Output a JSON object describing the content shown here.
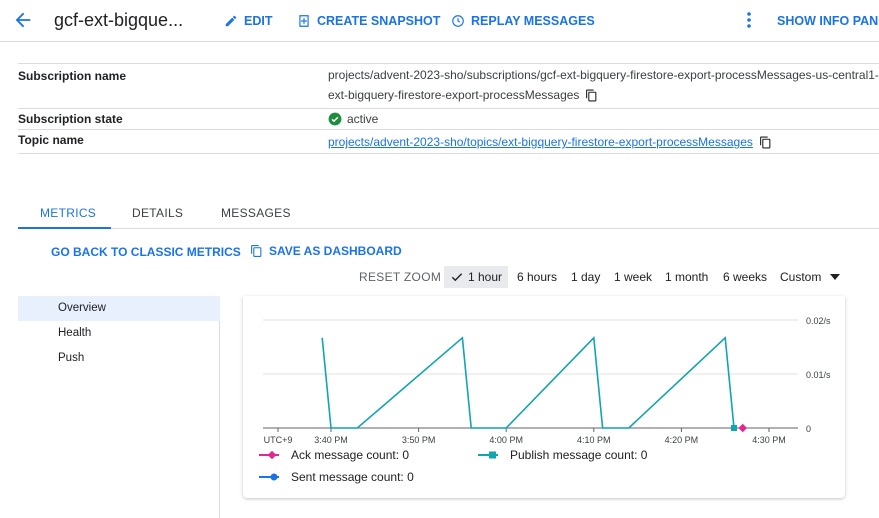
{
  "header": {
    "title": "gcf-ext-bigque...",
    "edit_label": "EDIT",
    "snapshot_label": "CREATE SNAPSHOT",
    "replay_label": "REPLAY MESSAGES",
    "info_panel_label": "SHOW INFO PANEL"
  },
  "details": {
    "subscription_name_label": "Subscription name",
    "subscription_name_line1": "projects/advent-2023-sho/subscriptions/gcf-ext-bigquery-firestore-export-processMessages-us-central1-",
    "subscription_name_line2": "ext-bigquery-firestore-export-processMessages",
    "subscription_state_label": "Subscription state",
    "subscription_state_value": "active",
    "topic_name_label": "Topic name",
    "topic_name_value": "projects/advent-2023-sho/topics/ext-bigquery-firestore-export-processMessages"
  },
  "tabs": [
    {
      "label": "METRICS",
      "active": true
    },
    {
      "label": "DETAILS",
      "active": false
    },
    {
      "label": "MESSAGES",
      "active": false
    }
  ],
  "actions": {
    "classic_metrics": "GO BACK TO CLASSIC METRICS",
    "save_dashboard": "SAVE AS DASHBOARD"
  },
  "time_range": {
    "reset_zoom": "RESET ZOOM",
    "options": [
      "1 hour",
      "6 hours",
      "1 day",
      "1 week",
      "1 month",
      "6 weeks",
      "Custom"
    ],
    "selected": "1 hour"
  },
  "left_nav": {
    "items": [
      "Overview",
      "Health",
      "Push"
    ],
    "selected": "Overview"
  },
  "chart_data": {
    "type": "line",
    "x_ticks": [
      "UTC+9",
      "3:40 PM",
      "3:50 PM",
      "4:00 PM",
      "4:10 PM",
      "4:20 PM",
      "4:30 PM"
    ],
    "y_ticks": [
      "0.02/s",
      "0.01/s",
      "0"
    ],
    "ylim": [
      0,
      0.02
    ],
    "series": [
      {
        "name": "Publish message count",
        "color": "#12a4af",
        "marker": "square",
        "points": [
          [
            "3:39 PM",
            0.0167
          ],
          [
            "3:40 PM",
            0
          ],
          [
            "3:43 PM",
            0
          ],
          [
            "3:55 PM",
            0.0167
          ],
          [
            "3:56 PM",
            0
          ],
          [
            "4:00 PM",
            0
          ],
          [
            "4:10 PM",
            0.0167
          ],
          [
            "4:11 PM",
            0
          ],
          [
            "4:14 PM",
            0
          ],
          [
            "4:25 PM",
            0.0167
          ],
          [
            "4:26 PM",
            0
          ]
        ]
      },
      {
        "name": "Ack message count",
        "color": "#e52592",
        "marker": "diamond",
        "points": [
          [
            "4:27 PM",
            0
          ]
        ]
      },
      {
        "name": "Sent message count",
        "color": "#1a73e8",
        "marker": "circle",
        "points": []
      }
    ],
    "legend": [
      {
        "label": "Ack message count:",
        "value": "0",
        "color": "#e52592",
        "marker": "diamond"
      },
      {
        "label": "Publish message count:",
        "value": "0",
        "color": "#12a4af",
        "marker": "square"
      },
      {
        "label": "Sent message count:",
        "value": "0",
        "color": "#1a73e8",
        "marker": "circle"
      }
    ],
    "grid": true
  },
  "colors": {
    "accent": "#1a73e8",
    "active_green": "#1e8e3e"
  }
}
